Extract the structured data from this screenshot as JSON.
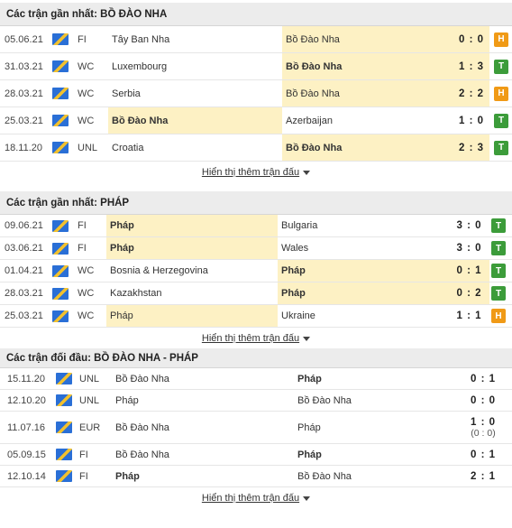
{
  "sections": [
    {
      "title": "Các trận gần nhất: BỒ ĐÀO NHA",
      "matches": [
        {
          "date": "05.06.21",
          "comp": "FI",
          "home": "Tây Ban Nha",
          "away": "Bồ Đào Nha",
          "score": "0 : 0",
          "result": "H",
          "hl": "score-away"
        },
        {
          "date": "31.03.21",
          "comp": "WC",
          "home": "Luxembourg",
          "away": "Bồ Đào Nha",
          "score": "1 : 3",
          "result": "T",
          "hl": "away-bold"
        },
        {
          "date": "28.03.21",
          "comp": "WC",
          "home": "Serbia",
          "away": "Bồ Đào Nha",
          "score": "2 : 2",
          "result": "H",
          "hl": "score-away"
        },
        {
          "date": "25.03.21",
          "comp": "WC",
          "home": "Bồ Đào Nha",
          "away": "Azerbaijan",
          "score": "1 : 0",
          "result": "T",
          "hl": "home-bold"
        },
        {
          "date": "18.11.20",
          "comp": "UNL",
          "home": "Croatia",
          "away": "Bồ Đào Nha",
          "score": "2 : 3",
          "result": "T",
          "hl": "away-bold"
        }
      ],
      "more": "Hiển thị thêm trận đấu"
    },
    {
      "title": "Các trận gần nhất: PHÁP",
      "matches": [
        {
          "date": "09.06.21",
          "comp": "FI",
          "home": "Pháp",
          "away": "Bulgaria",
          "score": "3 : 0",
          "result": "T",
          "hl": "home-bold"
        },
        {
          "date": "03.06.21",
          "comp": "FI",
          "home": "Pháp",
          "away": "Wales",
          "score": "3 : 0",
          "result": "T",
          "hl": "home-bold"
        },
        {
          "date": "01.04.21",
          "comp": "WC",
          "home": "Bosnia & Herzegovina",
          "away": "Pháp",
          "score": "0 : 1",
          "result": "T",
          "hl": "away-bold"
        },
        {
          "date": "28.03.21",
          "comp": "WC",
          "home": "Kazakhstan",
          "away": "Pháp",
          "score": "0 : 2",
          "result": "T",
          "hl": "away-bold"
        },
        {
          "date": "25.03.21",
          "comp": "WC",
          "home": "Pháp",
          "away": "Ukraine",
          "score": "1 : 1",
          "result": "H",
          "hl": "home"
        }
      ],
      "more": "Hiển thị thêm trận đấu"
    },
    {
      "title": "Các trận đối đầu: BỒ ĐÀO NHA - PHÁP",
      "matches": [
        {
          "date": "15.11.20",
          "comp": "UNL",
          "home": "Bồ Đào Nha",
          "away": "Pháp",
          "score": "0 : 1",
          "sub": "",
          "winner": "away"
        },
        {
          "date": "12.10.20",
          "comp": "UNL",
          "home": "Pháp",
          "away": "Bồ Đào Nha",
          "score": "0 : 0",
          "sub": "",
          "winner": ""
        },
        {
          "date": "11.07.16",
          "comp": "EUR",
          "home": "Bồ Đào Nha",
          "away": "Pháp",
          "score": "1 : 0",
          "sub": "(0 : 0)",
          "winner": ""
        },
        {
          "date": "05.09.15",
          "comp": "FI",
          "home": "Bồ Đào Nha",
          "away": "Pháp",
          "score": "0 : 1",
          "sub": "",
          "winner": "away"
        },
        {
          "date": "12.10.14",
          "comp": "FI",
          "home": "Pháp",
          "away": "Bồ Đào Nha",
          "score": "2 : 1",
          "sub": "",
          "winner": "home"
        }
      ],
      "more": "Hiển thị thêm trận đấu"
    }
  ]
}
